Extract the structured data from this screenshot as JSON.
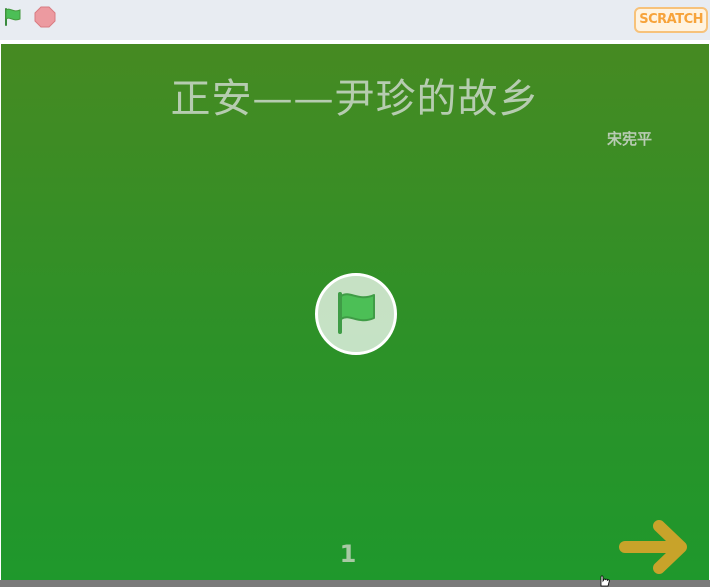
{
  "toolbar": {
    "green_flag_icon": "green-flag-icon",
    "stop_icon": "stop-sign-icon",
    "logo_text": "SCRATCH",
    "colors": {
      "background": "#e8ecf2",
      "flag": "#4cbf56",
      "stop": "#ec9aa0"
    }
  },
  "stage": {
    "title": "正安——尹珍的故乡",
    "author": "宋宪平",
    "page_number": "1",
    "play_button_icon": "green-flag-icon",
    "next_button_icon": "arrow-right-icon",
    "colors": {
      "gradient_top": "#468a22",
      "gradient_bottom": "#1f982c",
      "title": "#b6ccb0",
      "arrow": "#c8a32a"
    }
  }
}
